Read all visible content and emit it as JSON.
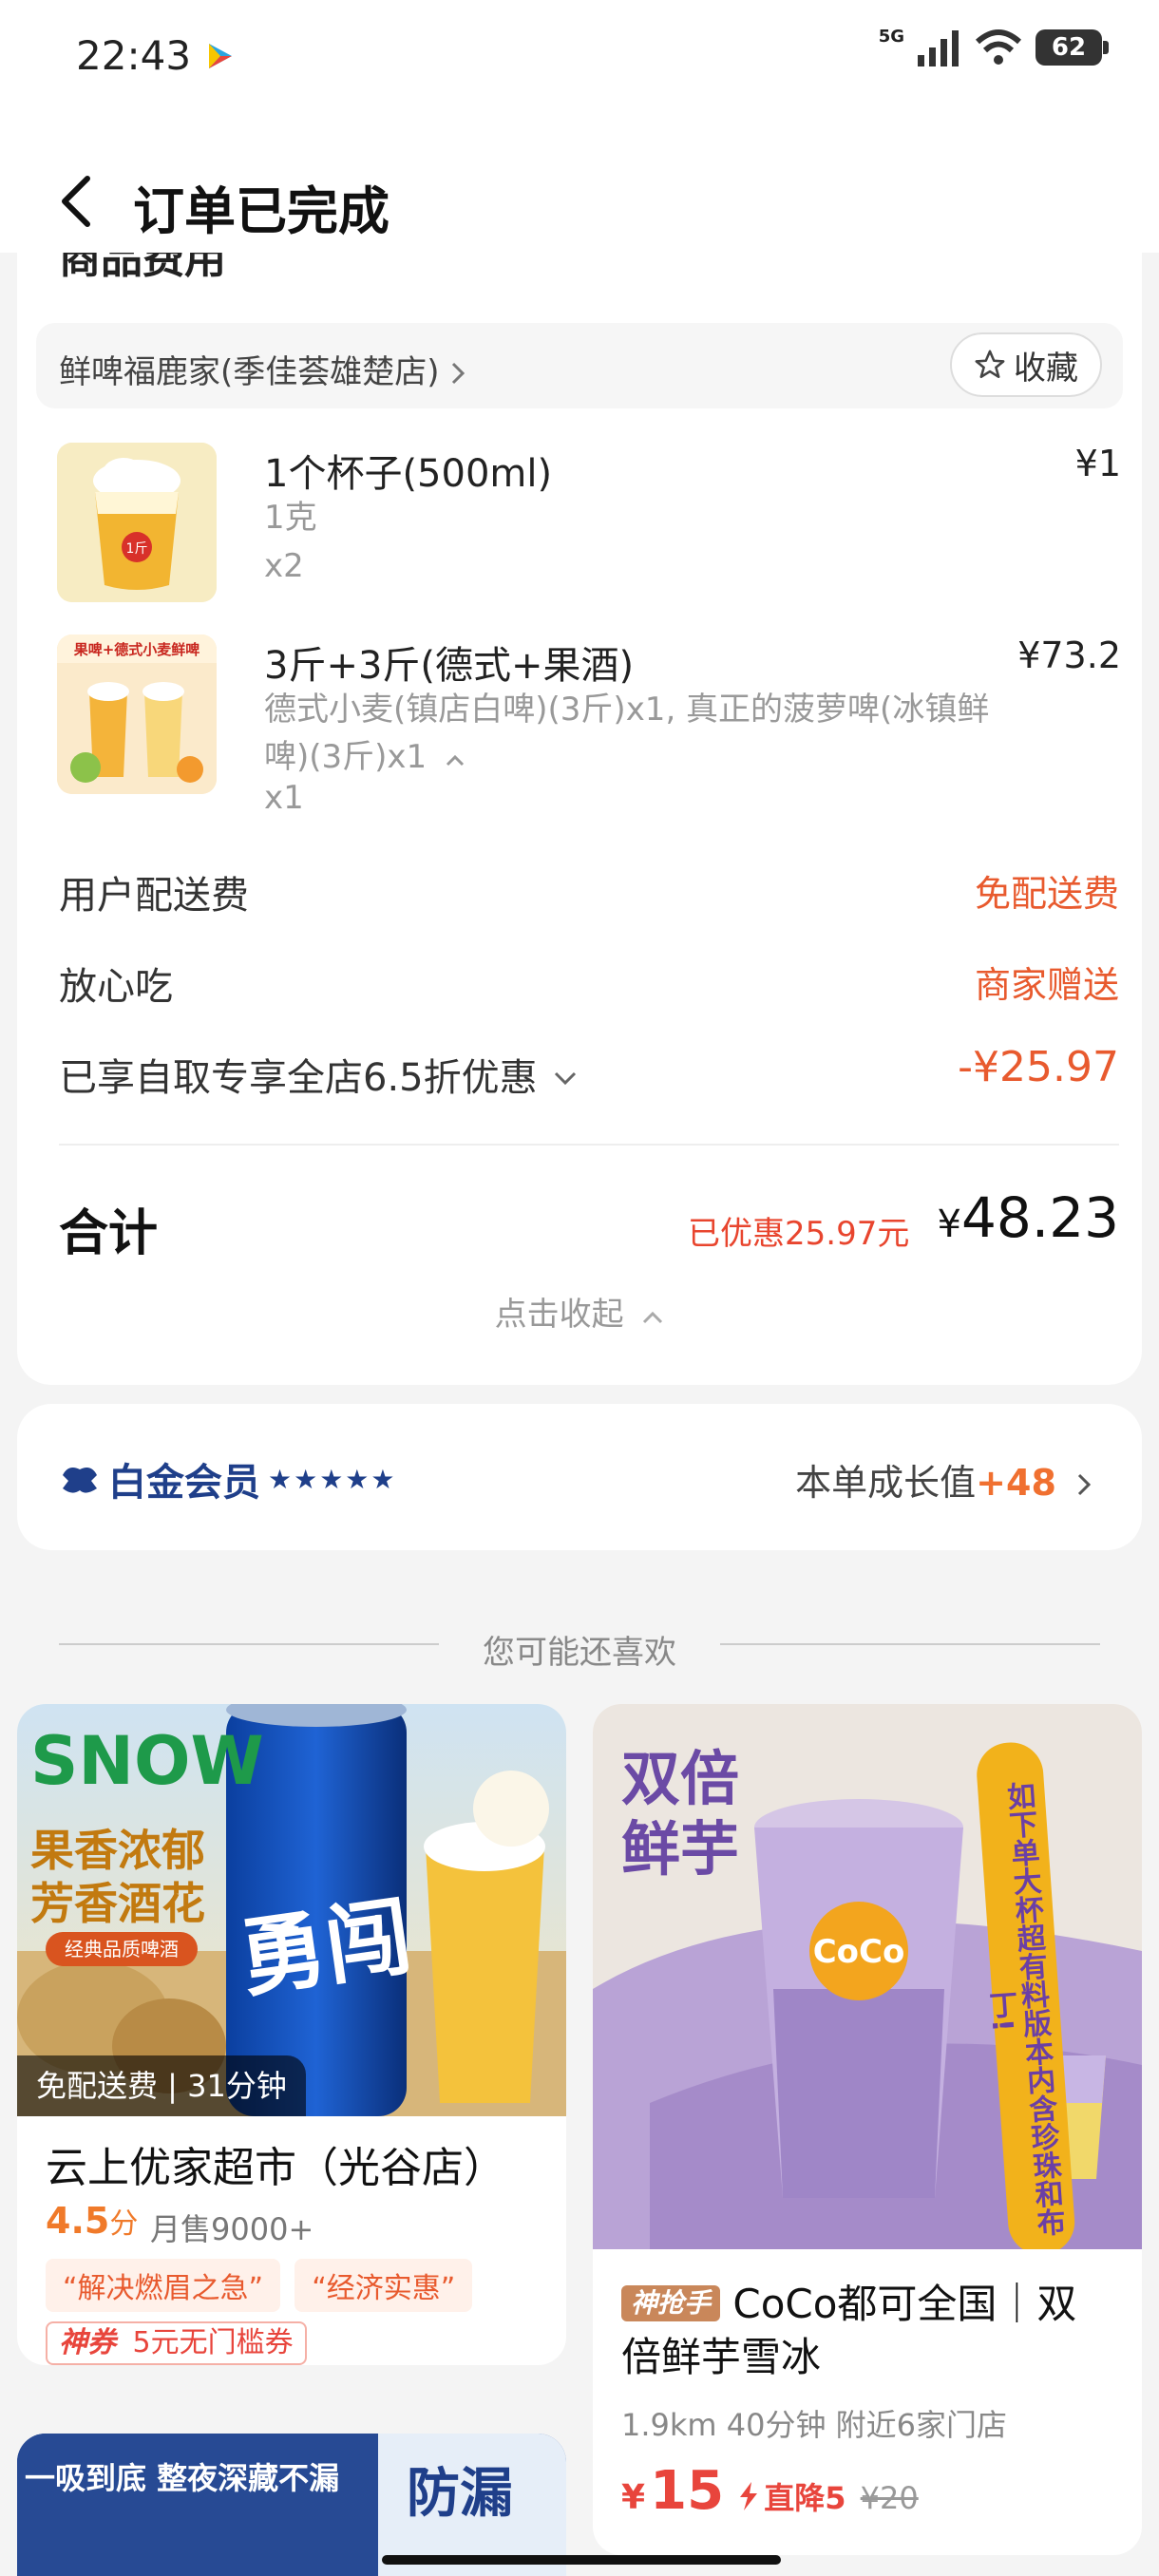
{
  "status_bar": {
    "time": "22:43",
    "network": "5G",
    "battery": "62"
  },
  "header": {
    "title": "订单已完成"
  },
  "order": {
    "section_title": "商品费用",
    "store_name": "鲜啤福鹿家(季佳荟雄楚店)",
    "fav_label": "收藏",
    "items": [
      {
        "name": "1个杯子(500ml)",
        "spec": "1克",
        "qty": "x2",
        "price": "¥1"
      },
      {
        "name": "3斤+3斤(德式+果酒)",
        "spec": "德式小麦(镇店白啤)(3斤)x1, 真正的菠萝啤(冰镇鲜啤)(3斤)x1",
        "qty": "x1",
        "price": "¥73.2",
        "thumb_text": "果啤+德式小麦鲜啤"
      }
    ],
    "fees": [
      {
        "label": "用户配送费",
        "value": "免配送费"
      },
      {
        "label": "放心吃",
        "value": "商家赠送"
      },
      {
        "label": "已享自取专享全店6.5折优惠",
        "value": "-¥25.97"
      }
    ],
    "total_label": "合计",
    "saved_text": "已优惠25.97元",
    "total_currency": "¥",
    "total_amount": "48.23",
    "collapse_label": "点击收起"
  },
  "member": {
    "level": "白金会员",
    "stars": "★★★★★",
    "growth_label": "本单成长值",
    "growth_value": "+48"
  },
  "recommend": {
    "section_label": "您可能还喜欢",
    "cards": [
      {
        "image_badge": "免配送费 | 31分钟",
        "image_text": [
          "SNOW",
          "果香浓郁",
          "芳香酒花",
          "经典品质啤酒",
          "勇闯"
        ],
        "title": "云上优家超市（光谷店）",
        "rating": "4.5",
        "rating_unit": "分",
        "monthly_sales": "月售9000+",
        "tags": [
          "“解决燃眉之急”",
          "“经济实惠”"
        ],
        "coupon_tag": "神券",
        "coupon_text": "5元无门槛券"
      },
      {
        "image_text": [
          "双倍",
          "鲜芋",
          "如下单大杯超有料版本内含珍珠和布丁!",
          "CoCo"
        ],
        "brand_tag": "神抢手",
        "title": "CoCo都可全国｜双倍鲜芋雪冰",
        "meta": "1.9km 40分钟 附近6家门店",
        "price_currency": "¥",
        "price": "15",
        "drop_label": "直降5",
        "original_price": "¥20"
      },
      {
        "image_text": [
          "一吸到底 整夜深藏不漏",
          "防漏"
        ]
      }
    ]
  },
  "colors": {
    "accent": "#e85a2e",
    "member_blue": "#1f3f8a",
    "bg": "#f4f4f4"
  }
}
